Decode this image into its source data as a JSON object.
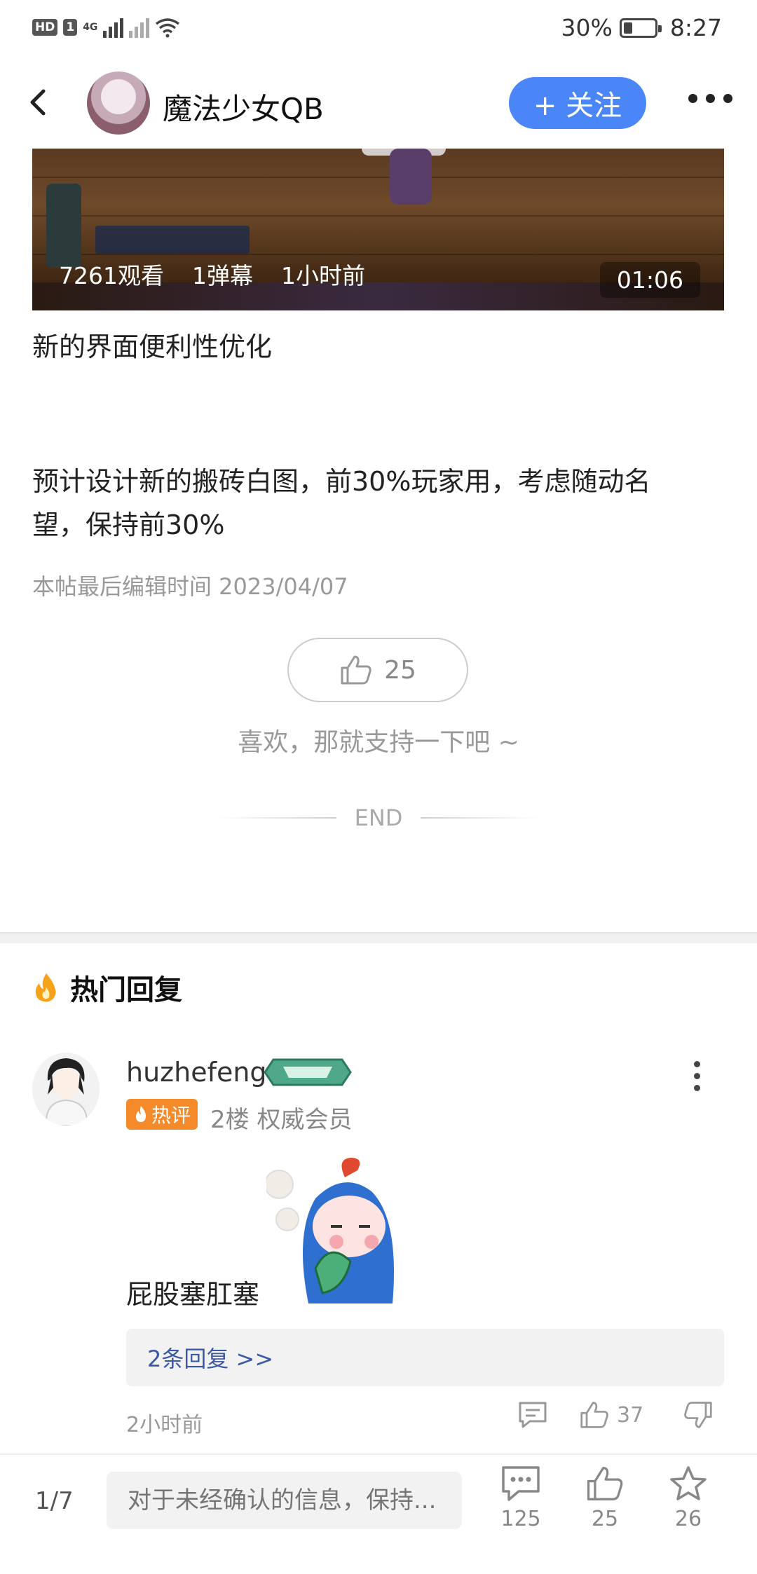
{
  "status_bar": {
    "hd": "HD",
    "sim": "1",
    "network": "4G",
    "battery": "30%",
    "time": "8:27"
  },
  "header": {
    "username": "魔法少女QB",
    "follow_label": "+ 关注"
  },
  "video": {
    "views": "7261观看",
    "danmaku": "1弹幕",
    "ago": "1小时前",
    "duration": "01:06"
  },
  "post": {
    "paragraph1": "新的界面便利性优化",
    "paragraph2_line1": "预计设计新的搬砖白图，前30%玩家用，考虑随动名",
    "paragraph2_line2": "望，保持前30%",
    "edit_time": "本帖最后编辑时间 2023/04/07",
    "like_count": "25",
    "support_text": "喜欢，那就支持一下吧 ~",
    "end_label": "END"
  },
  "hot_replies": {
    "title": "热门回复",
    "comment": {
      "username": "huzhefeng",
      "tag": "热评",
      "meta": "2楼 权威会员",
      "text": "屁股塞肛塞",
      "replies_link": "2条回复 >>",
      "time": "2小时前",
      "likes": "37"
    }
  },
  "bottom_bar": {
    "page": "1/7",
    "input_placeholder": "对于未经确认的信息，保持...",
    "comments": "125",
    "likes": "25",
    "favorites": "26"
  }
}
